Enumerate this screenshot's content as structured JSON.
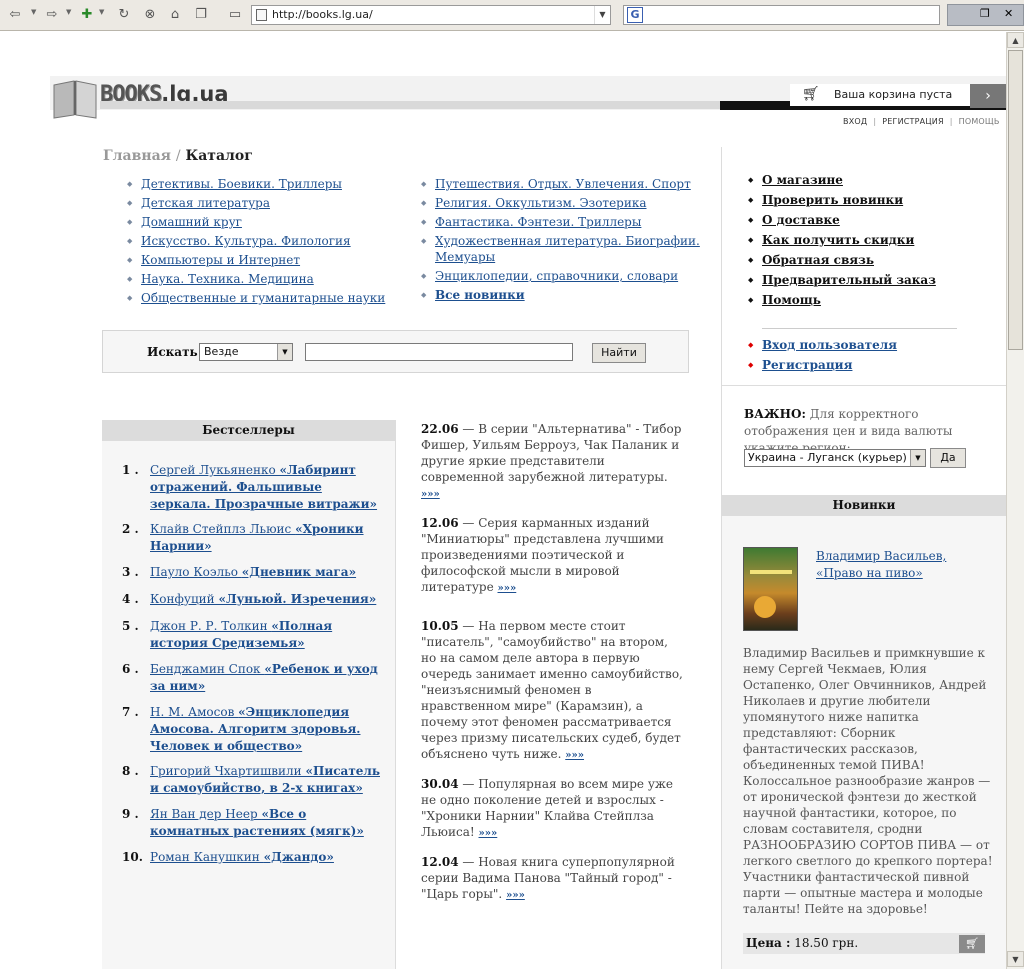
{
  "browser": {
    "url": "http://books.lg.ua/",
    "icons": [
      "back-icon",
      "forward-icon",
      "plugin-icon",
      "reload-icon",
      "stop-icon",
      "home-icon",
      "window-icon",
      "page-icon",
      "google-icon"
    ]
  },
  "header": {
    "logo_books": "BOOKS",
    "logo_domain": ".lg.ua",
    "cart_text": "Ваша корзина пуста",
    "cart_go": "›",
    "links": {
      "login": "ВХОД",
      "register": "РЕГИСТРАЦИЯ",
      "help": "ПОМОЩЬ"
    }
  },
  "breadcrumb": {
    "home": "Главная",
    "separator": "/",
    "current": "Каталог"
  },
  "categories": {
    "left": [
      "Детективы. Боевики. Триллеры",
      "Детская литература",
      "Домашний круг",
      "Искусство. Культура. Филология",
      "Компьютеры и Интернет",
      "Наука. Техника. Медицина",
      "Общественные и гуманитарные науки"
    ],
    "right": [
      "Путешествия. Отдых. Увлечения. Спорт",
      "Религия. Оккультизм. Эзотерика",
      "Фантастика. Фэнтези. Триллеры",
      "Художественная литература. Биографии. Мемуары",
      "Энциклопедии, справочники, словари",
      "Все новинки"
    ]
  },
  "search": {
    "label": "Искать",
    "scope": "Везде",
    "value": "",
    "button": "Найти"
  },
  "bestsellers": {
    "title": "Бестселлеры",
    "items": [
      {
        "num": "1 .",
        "author": "Сергей Лукьяненко ",
        "title": "«Лабиринт отражений. Фальшивые зеркала. Прозрачные витражи»"
      },
      {
        "num": "2 .",
        "author": "Клайв Стейплз Льюис ",
        "title": "«Хроники Нарнии»"
      },
      {
        "num": "3 .",
        "author": "Пауло Коэльо ",
        "title": "«Дневник мага»"
      },
      {
        "num": "4 .",
        "author": "Конфуций ",
        "title": "«Луньюй. Изречения»"
      },
      {
        "num": "5 .",
        "author": "Джон Р. Р. Толкин ",
        "title": "«Полная история Средиземья»"
      },
      {
        "num": "6 .",
        "author": "Бенджамин Спок ",
        "title": "«Ребенок и уход за ним»"
      },
      {
        "num": "7 .",
        "author": "Н. М. Амосов ",
        "title": "«Энциклопедия Амосова. Алгоритм здоровья. Человек и общество»"
      },
      {
        "num": "8 .",
        "author": "Григорий Чхартишвили ",
        "title": "«Писатель и самоубийство, в 2-х книгах»"
      },
      {
        "num": "9 .",
        "author": "Ян Ван дер Неер ",
        "title": "«Все о комнатных растениях (мягк)»"
      },
      {
        "num": "10.",
        "author": "Роман Канушкин ",
        "title": "«Джандо»"
      }
    ]
  },
  "news": [
    {
      "date": "22.06",
      "text": " — В серии \"Альтернатива\" - Тибор Фишер, Уильям Берроуз, Чак Паланик и другие яркие представители современной зарубежной литературы. ",
      "more": "»»»"
    },
    {
      "date": "12.06",
      "text": " — Серия карманных изданий \"Миниатюры\" представлена лучшими произведениями поэтической и философской мысли в мировой литературе ",
      "more": "»»»"
    },
    {
      "date": "10.05",
      "text": " — На первом месте стоит \"писатель\", \"самоубийство\" на втором, но на самом деле автора в первую очередь занимает именно самоубийство, \"неизъяснимый феномен в нравственном мире\" (Карамзин), а почему этот феномен рассматривается через призму писательских судеб, будет объяснено чуть ниже. ",
      "more": "»»»"
    },
    {
      "date": "30.04",
      "text": " — Популярная во всем мире уже не одно поколение детей и взрослых - \"Хроники Нарнии\" Клайва Стейплза Льюиса! ",
      "more": "»»»"
    },
    {
      "date": "12.04",
      "text": " — Новая книга суперпопулярной серии Вадима Панова \"Тайный город\" - \"Царь горы\". ",
      "more": "»»»"
    }
  ],
  "menu": [
    "О магазине",
    "Проверить новинки",
    "О доставке",
    "Как получить скидки",
    "Обратная связь",
    "Предварительный заказ",
    "Помощь"
  ],
  "user_menu": [
    "Вход пользователя",
    "Регистрация"
  ],
  "region": {
    "important_label": "ВАЖНО:",
    "important_text": " Для корректного отображения цен и вида валюты укажите регион:",
    "selected": "Украина - Луганск (курьер)",
    "button": "Да"
  },
  "new_arrivals": {
    "title": "Новинки",
    "book_link": "Владимир Васильев, «Право на пиво»",
    "description": "Владимир Васильев и примкнувшие к нему Сергей Чекмаев, Юлия Остапенко, Олег Овчинников, Андрей Николаев и другие любители упомянутого ниже напитка представляют: Сборник фантастических рассказов, объединенных темой ПИВА! Колоссальное разнообразие жанров — от иронической фэнтези до жесткой научной фантастики, которое, по словам составителя, сродни РАЗНООБРАЗИЮ СОРТОВ ПИВА — от легкого светлого до крепкого портера! Участники фантастической пивной парти — опытные мастера и молодые таланты! Пейте на здоровье!",
    "price_label": "Цена :",
    "price_value": " 18.50 грн."
  }
}
